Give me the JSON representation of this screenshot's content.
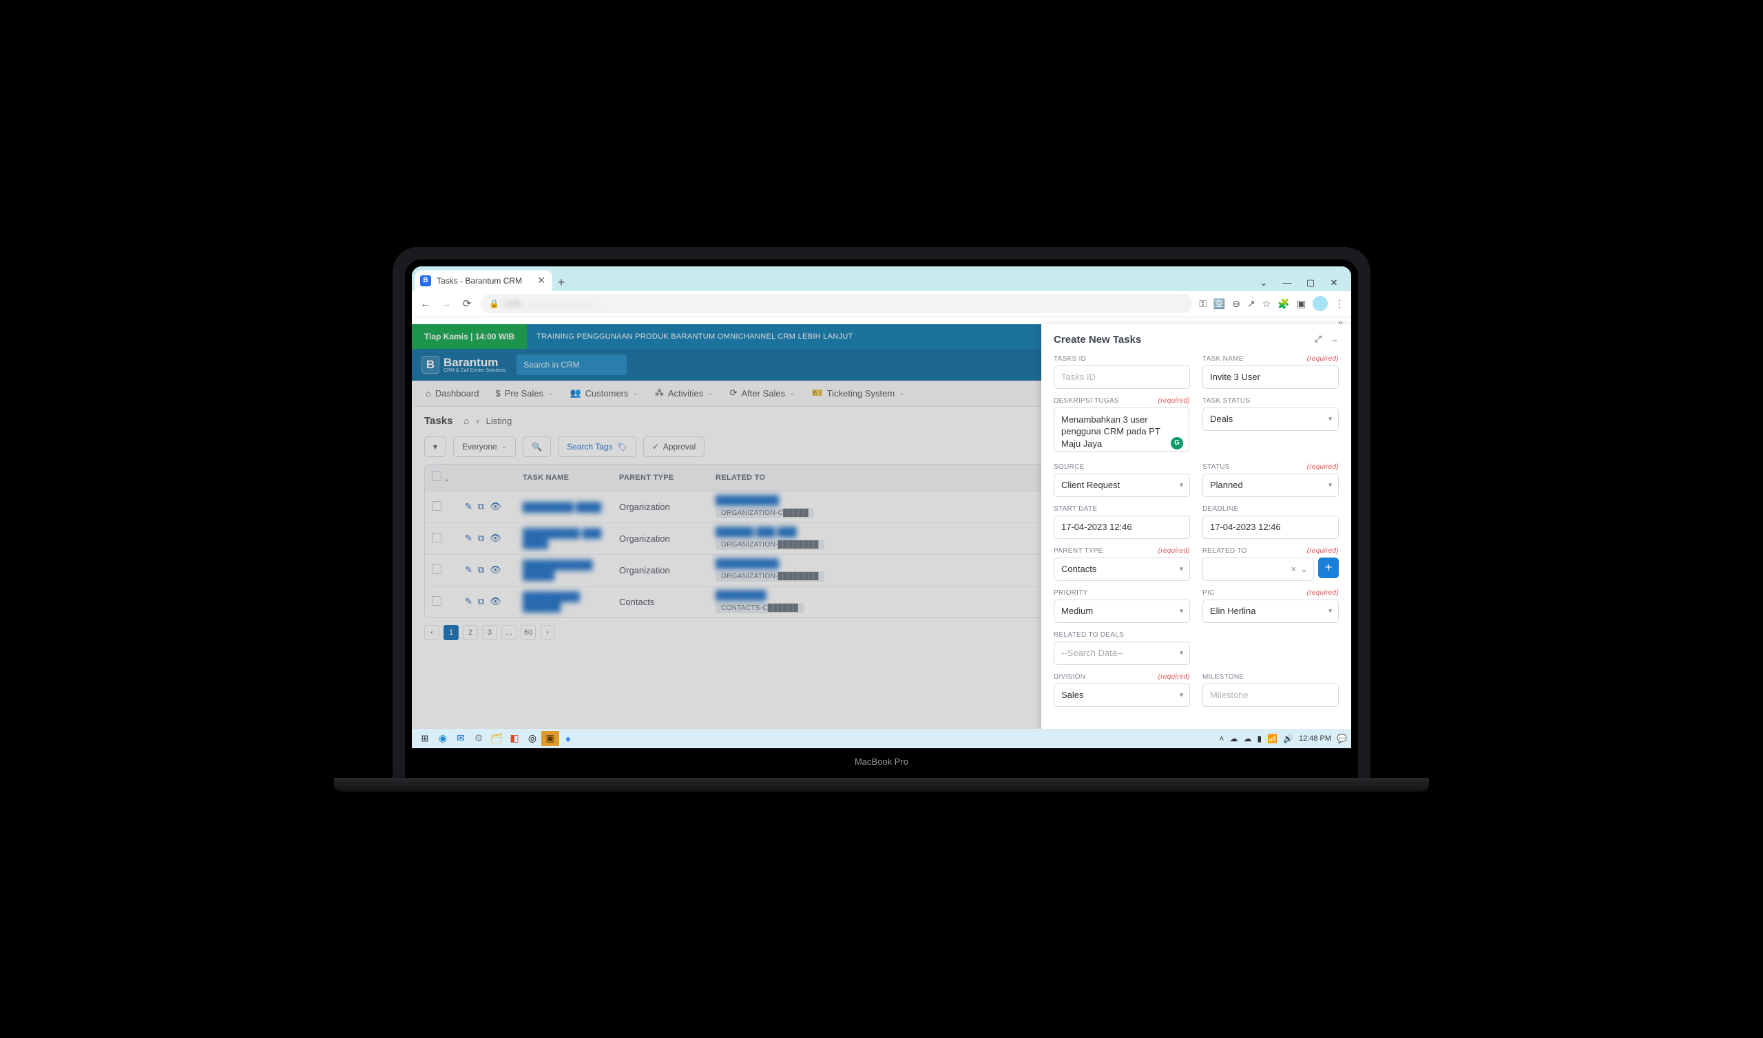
{
  "browser": {
    "tab_title": "Tasks - Barantum CRM",
    "omnibox_blurred": "crm..........................",
    "window_controls": {
      "down": "⌄",
      "min": "—",
      "max": "▢",
      "close": "✕"
    },
    "newtab": "+",
    "more": "»"
  },
  "banner": {
    "badge": "Tiap Kamis | 14:00 WIB",
    "text": "TRAINING PENGGUNAAN PRODUK BARANTUM OMNICHANNEL CRM LEBIH LANJUT"
  },
  "brand": {
    "name": "Barantum",
    "sub": "CRM & Call Center Solutions",
    "search_placeholder": "Search in CRM"
  },
  "menus": [
    {
      "icon": "⌂",
      "label": "Dashboard",
      "caret": false
    },
    {
      "icon": "$",
      "label": "Pre Sales",
      "caret": true
    },
    {
      "icon": "👥",
      "label": "Customers",
      "caret": true
    },
    {
      "icon": "⁂",
      "label": "Activities",
      "caret": true
    },
    {
      "icon": "⟳",
      "label": "After Sales",
      "caret": true
    },
    {
      "icon": "🎫",
      "label": "Ticketing System",
      "caret": true
    }
  ],
  "crumbs": {
    "title": "Tasks",
    "home": "⌂",
    "sep": "›",
    "leaf": "Listing"
  },
  "toolbar": {
    "filter_icon": "▾",
    "scope": "Everyone",
    "search_icon": "🔍",
    "search_tags": "Search Tags",
    "tag_icon": "🏷",
    "approval_icon": "✓",
    "approval": "Approval"
  },
  "table": {
    "headers": {
      "task": "TASK NAME",
      "parent": "PARENT TYPE",
      "related": "RELATED TO"
    },
    "rows": [
      {
        "name": "████████ ████",
        "parent": "Organization",
        "rel_top": "██████████",
        "chip": "ORGANIZATION-C█████"
      },
      {
        "name": "█████████ ███ ████",
        "parent": "Organization",
        "rel_top": "██████ ███ ███",
        "chip": "ORGANIZATION-████████"
      },
      {
        "name": "███████████ █████",
        "parent": "Organization",
        "rel_top": "██████████",
        "chip": "ORGANIZATION-████████"
      },
      {
        "name": "█████████ ██████",
        "parent": "Contacts",
        "rel_top": "████████",
        "chip": "CONTACTS-C██████"
      }
    ],
    "pages": [
      "‹",
      "1",
      "2",
      "3",
      "…",
      "60",
      "›"
    ],
    "active_page": "1"
  },
  "panel": {
    "title": "Create New Tasks",
    "required": "(required)",
    "labels": {
      "tasks_id": "TASKS ID",
      "task_name": "TASK NAME",
      "deskripsi": "DESKRIPSI TUGAS",
      "task_status": "TASK STATUS",
      "source": "SOURCE",
      "status": "STATUS",
      "start_date": "START DATE",
      "deadline": "DEADLINE",
      "parent_type": "PARENT TYPE",
      "related_to": "RELATED TO",
      "priority": "PRIORITY",
      "pic": "PIC",
      "related_deals": "RELATED TO DEALS",
      "division": "DIVISION",
      "milestone": "MILESTONE"
    },
    "placeholders": {
      "tasks_id": "Tasks ID",
      "related_deals": "--Search Data--",
      "milestone": "Milestone"
    },
    "values": {
      "task_name": "Invite 3 User",
      "deskripsi_html": "Menambahkan 3 user pengguna CRM pada PT Maju Jaya",
      "task_status": "Deals",
      "source": "Client Request",
      "status": "Planned",
      "start_date": "17-04-2023 12:46",
      "deadline": "17-04-2023 12:46",
      "parent_type": "Contacts",
      "priority": "Medium",
      "pic": "Elin Herlina",
      "division": "Sales"
    }
  },
  "taskbar": {
    "clock": "12:48 PM"
  }
}
